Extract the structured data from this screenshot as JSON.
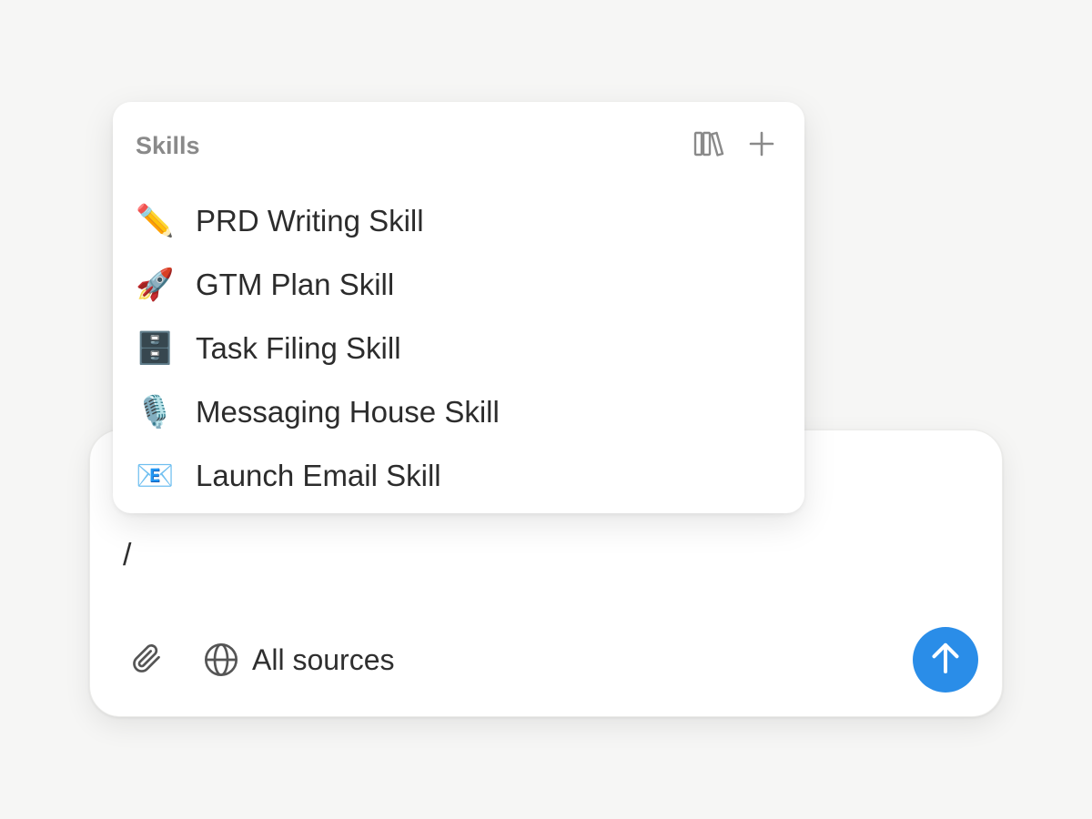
{
  "skills_menu": {
    "title": "Skills",
    "library_icon": "library-books-icon",
    "add_icon": "plus-icon",
    "items": [
      {
        "emoji": "✏️",
        "icon": "pencil-icon",
        "label": "PRD Writing Skill"
      },
      {
        "emoji": "🚀",
        "icon": "rocket-icon",
        "label": "GTM Plan Skill"
      },
      {
        "emoji": "🗄️",
        "icon": "file-cabinet-icon",
        "label": "Task Filing Skill"
      },
      {
        "emoji": "🎙️",
        "icon": "microphone-icon",
        "label": "Messaging House Skill"
      },
      {
        "emoji": "📧",
        "icon": "email-icon",
        "label": "Launch Email Skill"
      }
    ]
  },
  "composer": {
    "input_value": "/",
    "attach_icon": "paperclip-icon",
    "sources_icon": "globe-icon",
    "sources_label": "All sources",
    "send_icon": "arrow-up-icon",
    "send_color": "#2a8de8"
  }
}
